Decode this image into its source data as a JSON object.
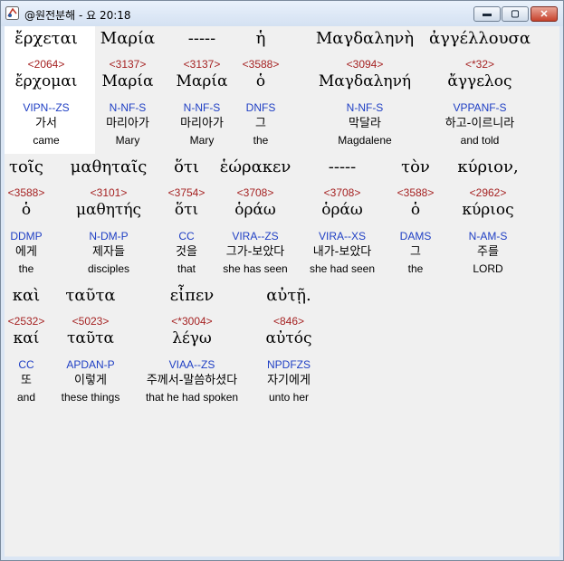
{
  "window": {
    "title": "@원전분해 - 요 20:18",
    "minimize_glyph": "▬",
    "maximize_glyph": "▢",
    "close_glyph": "✕"
  },
  "rows": [
    [
      {
        "greek": "ἔρχεται",
        "strong": "<2064>",
        "lemma": "ἔρχομαι",
        "morph": "VIPN--ZS",
        "korean": "가서",
        "english": "came"
      },
      {
        "greek": "Μαρία",
        "strong": "<3137>",
        "lemma": "Μαρία",
        "morph": "N-NF-S",
        "korean": "마리아가",
        "english": "Mary"
      },
      {
        "greek": "-----",
        "strong": "<3137>",
        "lemma": "Μαρία",
        "morph": "N-NF-S",
        "korean": "마리아가",
        "english": "Mary"
      },
      {
        "greek": "ἡ",
        "strong": "<3588>",
        "lemma": "ὁ",
        "morph": "DNFS",
        "korean": "그",
        "english": "the"
      },
      {
        "greek": "Μαγδαληνὴ",
        "strong": "<3094>",
        "lemma": "Μαγδαληνή",
        "morph": "N-NF-S",
        "korean": "막달라",
        "english": "Magdalene"
      },
      {
        "greek": "ἀγγέλλουσα",
        "strong": "<*32>",
        "lemma": "ἄγγελος",
        "morph": "VPPANF-S",
        "korean": "하고-이르니라",
        "english": "and told"
      }
    ],
    [
      {
        "greek": "τοῖς",
        "strong": "<3588>",
        "lemma": "ὁ",
        "morph": "DDMP",
        "korean": "에게",
        "english": "the"
      },
      {
        "greek": "μαθηταῖς",
        "strong": "<3101>",
        "lemma": "μαθητής",
        "morph": "N-DM-P",
        "korean": "제자들",
        "english": "disciples"
      },
      {
        "greek": "ὅτι",
        "strong": "<3754>",
        "lemma": "ὅτι",
        "morph": "CC",
        "korean": "것을",
        "english": "that"
      },
      {
        "greek": "ἑώρακεν",
        "strong": "<3708>",
        "lemma": "ὁράω",
        "morph": "VIRA--ZS",
        "korean": "그가-보았다",
        "english": "she has seen"
      },
      {
        "greek": "-----",
        "strong": "<3708>",
        "lemma": "ὁράω",
        "morph": "VIRA--XS",
        "korean": "내가-보았다",
        "english": "she had seen"
      },
      {
        "greek": "τὸν",
        "strong": "<3588>",
        "lemma": "ὁ",
        "morph": "DAMS",
        "korean": "그",
        "english": "the"
      },
      {
        "greek": "κύριον,",
        "strong": "<2962>",
        "lemma": "κύριος",
        "morph": "N-AM-S",
        "korean": "주를",
        "english": "LORD"
      }
    ],
    [
      {
        "greek": "καὶ",
        "strong": "<2532>",
        "lemma": "καί",
        "morph": "CC",
        "korean": "또",
        "english": "and"
      },
      {
        "greek": "ταῦτα",
        "strong": "<5023>",
        "lemma": "ταῦτα",
        "morph": "APDAN-P",
        "korean": "이렇게",
        "english": "these things"
      },
      {
        "greek": "εἶπεν",
        "strong": "<*3004>",
        "lemma": "λέγω",
        "morph": "VIAA--ZS",
        "korean": "주께서-말씀하셨다",
        "english": "that he had spoken"
      },
      {
        "greek": "αὐτῇ.",
        "strong": "<846>",
        "lemma": "αὐτός",
        "morph": "NPDFZS",
        "korean": "자기에게",
        "english": "unto her"
      }
    ]
  ]
}
